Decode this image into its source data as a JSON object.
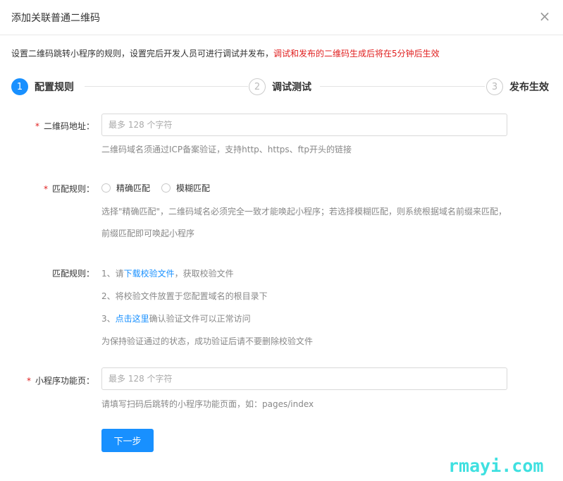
{
  "dialog": {
    "title": "添加关联普通二维码",
    "close_glyph": "×"
  },
  "notice": {
    "text": "设置二维码跳转小程序的规则，设置完后开发人员可进行调试并发布，",
    "warning": "调试和发布的二维码生成后将在5分钟后生效"
  },
  "steps": [
    {
      "number": "1",
      "label": "配置规则",
      "active": true
    },
    {
      "number": "2",
      "label": "调试测试",
      "active": false
    },
    {
      "number": "3",
      "label": "发布生效",
      "active": false
    }
  ],
  "form": {
    "required_mark": "*",
    "qr_address": {
      "label": "二维码地址：",
      "placeholder": "最多 128 个字符",
      "value": "",
      "hint": "二维码域名须通过ICP备案验证，支持http、https、ftp开头的链接"
    },
    "match_rule": {
      "label": "匹配规则：",
      "options": [
        "精确匹配",
        "模糊匹配"
      ],
      "hint_line1": "选择\"精确匹配\"，二维码域名必须完全一致才能唤起小程序；若选择模糊匹配，则系统根据域名前缀来匹配，",
      "hint_line2": "前缀匹配即可唤起小程序"
    },
    "verify_rule": {
      "label": "匹配规则：",
      "step1_prefix": "1、请",
      "step1_link": "下载校验文件",
      "step1_suffix": "，获取校验文件",
      "step2": "2、将校验文件放置于您配置域名的根目录下",
      "step3_prefix": "3、",
      "step3_link": "点击这里",
      "step3_suffix": "确认验证文件可以正常访问",
      "note": "为保持验证通过的状态，成功验证后请不要删除校验文件"
    },
    "mini_page": {
      "label": "小程序功能页：",
      "placeholder": "最多 128 个字符",
      "value": "",
      "hint": "请填写扫码后跳转的小程序功能页面，如：pages/index"
    },
    "next_button": "下一步"
  },
  "watermark": "rmayi.com",
  "colors": {
    "primary": "#1890ff",
    "required": "#e02020",
    "hint": "#888888",
    "watermark": "#3fe0e0"
  }
}
